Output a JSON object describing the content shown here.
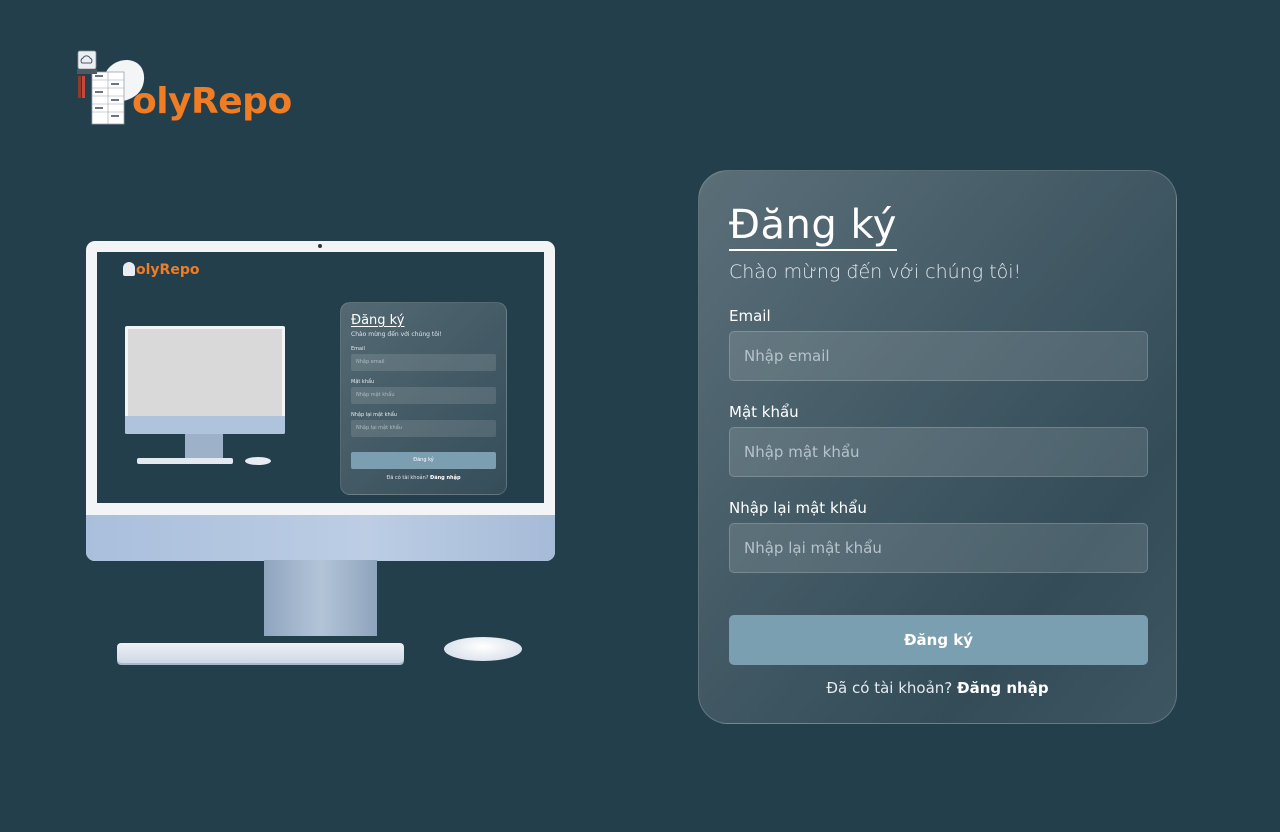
{
  "brand": {
    "name": "olyRepo",
    "accent_color": "#f07c24",
    "logo_icon": "server-cloud-icon"
  },
  "register": {
    "title": "Đăng ký",
    "subtitle": "Chào mừng đến với chúng tôi!",
    "email": {
      "label": "Email",
      "placeholder": "Nhập email"
    },
    "password": {
      "label": "Mật khẩu",
      "placeholder": "Nhập mật khẩu"
    },
    "confirm_password": {
      "label": "Nhập lại mật khẩu",
      "placeholder": "Nhập lại mật khẩu"
    },
    "submit_label": "Đăng ký",
    "footer_text": "Đã có tài khoản?",
    "login_link": "Đăng nhập"
  },
  "illustration": {
    "brand": "olyRepo",
    "title": "Đăng ký",
    "subtitle": "Chào mừng đến với chúng tôi!",
    "email_label": "Email",
    "email_placeholder": "Nhập email",
    "password_label": "Mật khẩu",
    "password_placeholder": "Nhập mật khẩu",
    "confirm_label": "Nhập lại mật khẩu",
    "confirm_placeholder": "Nhập lại mật khẩu",
    "submit_label": "Đăng ký",
    "footer_text": "Đã có tài khoản?",
    "login_link": "Đăng nhập"
  },
  "colors": {
    "background": "#243f4c",
    "button": "#7a9fb0"
  }
}
